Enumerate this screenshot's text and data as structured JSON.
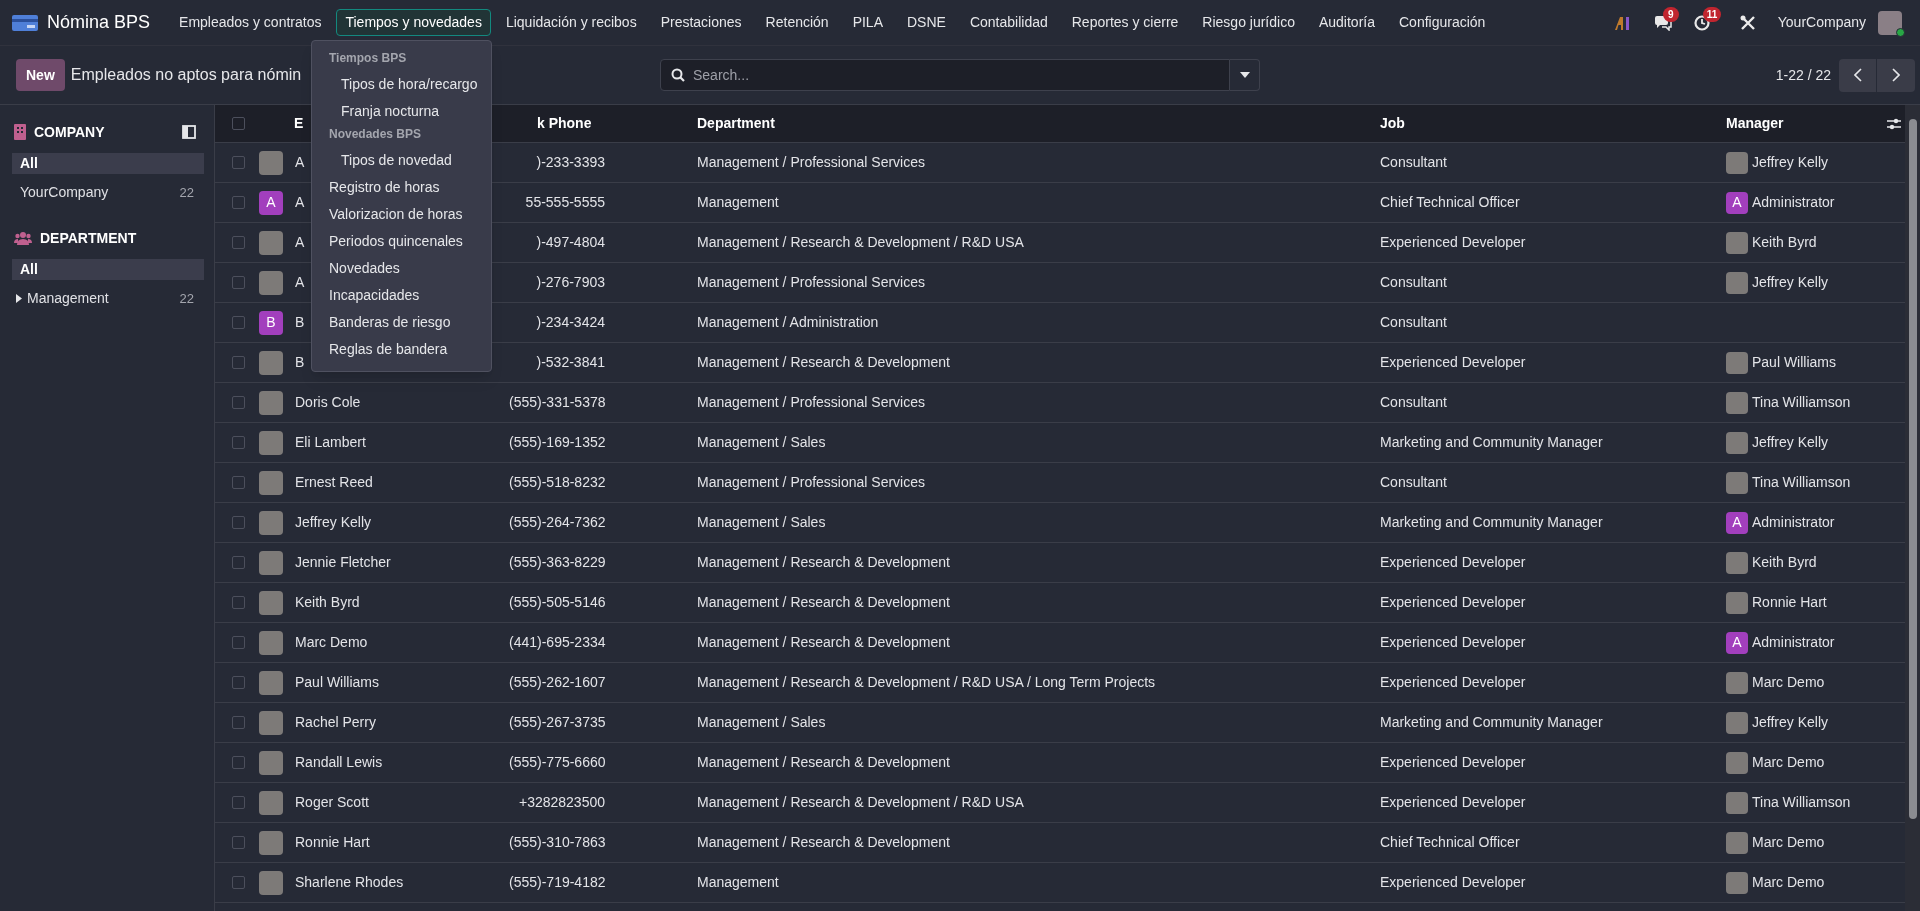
{
  "app": {
    "name": "Nómina BPS"
  },
  "nav": [
    {
      "label": "Empleados y contratos",
      "selected": false
    },
    {
      "label": "Tiempos y novedades",
      "selected": true
    },
    {
      "label": "Liquidación y recibos",
      "selected": false
    },
    {
      "label": "Prestaciones",
      "selected": false
    },
    {
      "label": "Retención",
      "selected": false
    },
    {
      "label": "PILA",
      "selected": false
    },
    {
      "label": "DSNE",
      "selected": false
    },
    {
      "label": "Contabilidad",
      "selected": false
    },
    {
      "label": "Reportes y cierre",
      "selected": false
    },
    {
      "label": "Riesgo jurídico",
      "selected": false
    },
    {
      "label": "Auditoría",
      "selected": false
    },
    {
      "label": "Configuración",
      "selected": false
    }
  ],
  "systray": {
    "messages_count": "9",
    "activities_count": "11",
    "company": "YourCompany"
  },
  "menu": [
    {
      "kind": "header",
      "label": "Tiempos BPS"
    },
    {
      "kind": "subitem",
      "label": "Tipos de hora/recargo"
    },
    {
      "kind": "subitem",
      "label": "Franja nocturna"
    },
    {
      "kind": "header",
      "label": "Novedades BPS"
    },
    {
      "kind": "subitem",
      "label": "Tipos de novedad"
    },
    {
      "kind": "item",
      "label": "Registro de horas"
    },
    {
      "kind": "item",
      "label": "Valorizacion de horas"
    },
    {
      "kind": "item",
      "label": "Periodos quincenales"
    },
    {
      "kind": "item",
      "label": "Novedades"
    },
    {
      "kind": "item",
      "label": "Incapacidades"
    },
    {
      "kind": "item",
      "label": "Banderas de riesgo"
    },
    {
      "kind": "item",
      "label": "Reglas de bandera"
    }
  ],
  "control_panel": {
    "new_button": "New",
    "title": "Empleados no aptos para nómin",
    "search_placeholder": "Search...",
    "pager": "1-22 / 22"
  },
  "sidebar": [
    {
      "title": "COMPANY",
      "kind": "company",
      "items": [
        {
          "label": "All",
          "selected": true
        },
        {
          "label": "YourCompany",
          "count": "22",
          "selected": false
        }
      ]
    },
    {
      "title": "DEPARTMENT",
      "kind": "department",
      "items": [
        {
          "label": "All",
          "selected": true
        },
        {
          "label": "Management",
          "count": "22",
          "selected": false,
          "expanded": false
        }
      ]
    }
  ],
  "table": {
    "all_checked": false,
    "columns": [
      "E",
      "k Phone",
      "Department",
      "Job",
      "Manager"
    ],
    "rows": [
      {
        "checked": false,
        "avatar": {
          "kind": "photo"
        },
        "name": "A",
        "phone": ")-233-3393",
        "department": "Management / Professional Services",
        "job": "Consultant",
        "manager": {
          "name": "Jeffrey Kelly",
          "avatar": {
            "kind": "photo"
          }
        }
      },
      {
        "checked": false,
        "avatar": {
          "kind": "letter",
          "letter": "A",
          "color": "#a23fbd"
        },
        "name": "A",
        "phone": "55-555-5555",
        "department": "Management",
        "job": "Chief Technical Officer",
        "manager": {
          "name": "Administrator",
          "avatar": {
            "kind": "letter",
            "letter": "A",
            "color": "#a23fbd"
          }
        }
      },
      {
        "checked": false,
        "avatar": {
          "kind": "photo"
        },
        "name": "A",
        "phone": ")-497-4804",
        "department": "Management / Research & Development / R&D USA",
        "job": "Experienced Developer",
        "manager": {
          "name": "Keith Byrd",
          "avatar": {
            "kind": "photo"
          }
        }
      },
      {
        "checked": false,
        "avatar": {
          "kind": "photo"
        },
        "name": "A",
        "phone": ")-276-7903",
        "department": "Management / Professional Services",
        "job": "Consultant",
        "manager": {
          "name": "Jeffrey Kelly",
          "avatar": {
            "kind": "photo"
          }
        }
      },
      {
        "checked": false,
        "avatar": {
          "kind": "letter",
          "letter": "B",
          "color": "#a23fbd"
        },
        "name": "B",
        "phone": ")-234-3424",
        "department": "Management / Administration",
        "job": "Consultant"
      },
      {
        "checked": false,
        "avatar": {
          "kind": "photo"
        },
        "name": "B",
        "phone": ")-532-3841",
        "department": "Management / Research & Development",
        "job": "Experienced Developer",
        "manager": {
          "name": "Paul Williams",
          "avatar": {
            "kind": "photo"
          }
        }
      },
      {
        "checked": false,
        "avatar": {
          "kind": "photo"
        },
        "name": "Doris Cole",
        "phone": "(555)-331-5378",
        "department": "Management / Professional Services",
        "job": "Consultant",
        "manager": {
          "name": "Tina Williamson",
          "avatar": {
            "kind": "photo"
          }
        }
      },
      {
        "checked": false,
        "avatar": {
          "kind": "photo"
        },
        "name": "Eli Lambert",
        "phone": "(555)-169-1352",
        "department": "Management / Sales",
        "job": "Marketing and Community Manager",
        "manager": {
          "name": "Jeffrey Kelly",
          "avatar": {
            "kind": "photo"
          }
        }
      },
      {
        "checked": false,
        "avatar": {
          "kind": "photo"
        },
        "name": "Ernest Reed",
        "phone": "(555)-518-8232",
        "department": "Management / Professional Services",
        "job": "Consultant",
        "manager": {
          "name": "Tina Williamson",
          "avatar": {
            "kind": "photo"
          }
        }
      },
      {
        "checked": false,
        "avatar": {
          "kind": "photo"
        },
        "name": "Jeffrey Kelly",
        "phone": "(555)-264-7362",
        "department": "Management / Sales",
        "job": "Marketing and Community Manager",
        "manager": {
          "name": "Administrator",
          "avatar": {
            "kind": "letter",
            "letter": "A",
            "color": "#a23fbd"
          }
        }
      },
      {
        "checked": false,
        "avatar": {
          "kind": "photo"
        },
        "name": "Jennie Fletcher",
        "phone": "(555)-363-8229",
        "department": "Management / Research & Development",
        "job": "Experienced Developer",
        "manager": {
          "name": "Keith Byrd",
          "avatar": {
            "kind": "photo"
          }
        }
      },
      {
        "checked": false,
        "avatar": {
          "kind": "photo"
        },
        "name": "Keith Byrd",
        "phone": "(555)-505-5146",
        "department": "Management / Research & Development",
        "job": "Experienced Developer",
        "manager": {
          "name": "Ronnie Hart",
          "avatar": {
            "kind": "photo"
          }
        }
      },
      {
        "checked": false,
        "avatar": {
          "kind": "photo"
        },
        "name": "Marc Demo",
        "phone": "(441)-695-2334",
        "department": "Management / Research & Development",
        "job": "Experienced Developer",
        "manager": {
          "name": "Administrator",
          "avatar": {
            "kind": "letter",
            "letter": "A",
            "color": "#a23fbd"
          }
        }
      },
      {
        "checked": false,
        "avatar": {
          "kind": "photo"
        },
        "name": "Paul Williams",
        "phone": "(555)-262-1607",
        "department": "Management / Research & Development / R&D USA / Long Term Projects",
        "job": "Experienced Developer",
        "manager": {
          "name": "Marc Demo",
          "avatar": {
            "kind": "photo"
          }
        }
      },
      {
        "checked": false,
        "avatar": {
          "kind": "photo"
        },
        "name": "Rachel Perry",
        "phone": "(555)-267-3735",
        "department": "Management / Sales",
        "job": "Marketing and Community Manager",
        "manager": {
          "name": "Jeffrey Kelly",
          "avatar": {
            "kind": "photo"
          }
        }
      },
      {
        "checked": false,
        "avatar": {
          "kind": "photo"
        },
        "name": "Randall Lewis",
        "phone": "(555)-775-6660",
        "department": "Management / Research & Development",
        "job": "Experienced Developer",
        "manager": {
          "name": "Marc Demo",
          "avatar": {
            "kind": "photo"
          }
        }
      },
      {
        "checked": false,
        "avatar": {
          "kind": "photo"
        },
        "name": "Roger Scott",
        "phone": "+3282823500",
        "department": "Management / Research & Development / R&D USA",
        "job": "Experienced Developer",
        "manager": {
          "name": "Tina Williamson",
          "avatar": {
            "kind": "photo"
          }
        }
      },
      {
        "checked": false,
        "avatar": {
          "kind": "photo"
        },
        "name": "Ronnie Hart",
        "phone": "(555)-310-7863",
        "department": "Management / Research & Development",
        "job": "Chief Technical Officer",
        "manager": {
          "name": "Marc Demo",
          "avatar": {
            "kind": "photo"
          }
        }
      },
      {
        "checked": false,
        "avatar": {
          "kind": "photo"
        },
        "name": "Sharlene Rhodes",
        "phone": "(555)-719-4182",
        "department": "Management",
        "job": "Experienced Developer",
        "manager": {
          "name": "Marc Demo",
          "avatar": {
            "kind": "photo"
          }
        }
      }
    ]
  }
}
